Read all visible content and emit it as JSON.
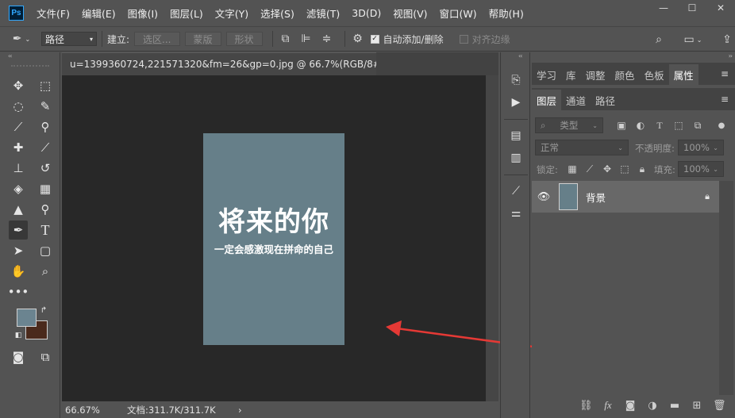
{
  "menu": [
    "文件(F)",
    "编辑(E)",
    "图像(I)",
    "图层(L)",
    "文字(Y)",
    "选择(S)",
    "滤镜(T)",
    "3D(D)",
    "视图(V)",
    "窗口(W)",
    "帮助(H)"
  ],
  "app_logo": "Ps",
  "options": {
    "mode_select": "路径",
    "build_label": "建立:",
    "selection_btn": "选区...",
    "mask_btn": "蒙版",
    "shape_btn": "形状",
    "auto_add_delete": "自动添加/删除",
    "align_edges": "对齐边缘"
  },
  "document": {
    "tab_title": "u=1399360724,221571320&fm=26&gp=0.jpg @ 66.7%(RGB/8#)",
    "close_glyph": "×",
    "title_text": "将来的你",
    "subtitle_text": "一定会感激现在拼命的自己",
    "zoom": "66.67%",
    "doc_size": "文档:311.7K/311.7K",
    "status_arrow": "›"
  },
  "panels": {
    "top_tabs": [
      "学习",
      "库",
      "调整",
      "颜色",
      "色板",
      "属性"
    ],
    "top_active": "属性",
    "layer_tabs": [
      "图层",
      "通道",
      "路径"
    ],
    "layer_active": "图层",
    "filter_kind": "类型",
    "blend_mode": "正常",
    "opacity_label": "不透明度:",
    "opacity_value": "100%",
    "lock_label": "锁定:",
    "fill_label": "填充:",
    "fill_value": "100%",
    "layer_name": "背景"
  },
  "colors": {
    "foreground": "#6b8490",
    "background": "#4a2a1c",
    "annotation_arrow": "#e53935"
  }
}
